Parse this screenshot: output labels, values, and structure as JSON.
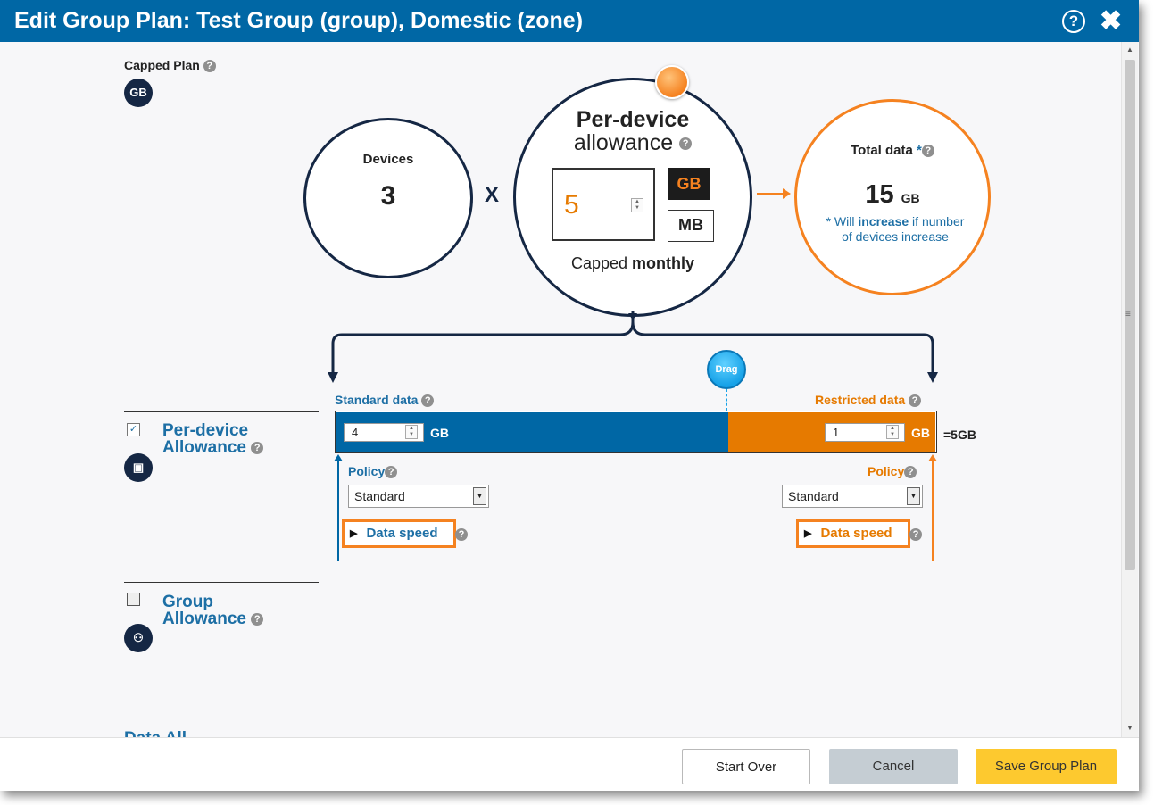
{
  "dialog": {
    "title": "Edit Group Plan: Test Group (group), Domestic (zone)",
    "help_icon": "?",
    "close_icon": "✖"
  },
  "plan": {
    "label": "Capped Plan",
    "badge": "GB"
  },
  "devices": {
    "label": "Devices",
    "value": "3"
  },
  "multiply": "X",
  "per_device": {
    "title_line1": "Per-device",
    "title_line2": "allowance",
    "value": "5",
    "unit_gb": "GB",
    "unit_mb": "MB",
    "capped_prefix": "Capped ",
    "capped_bold": "monthly",
    "selected_unit": "GB"
  },
  "total": {
    "label": "Total data",
    "asterisk": "*",
    "value": "15",
    "unit": "GB",
    "note_prefix": "* Will ",
    "note_bold": "increase",
    "note_suffix": " if number of devices increase"
  },
  "split": {
    "standard_label": "Standard data",
    "restricted_label": "Restricted data",
    "standard_value": "4",
    "restricted_value": "1",
    "unit": "GB",
    "total_label": "=5GB",
    "drag_label": "Drag",
    "standard_fraction": 0.8
  },
  "policy": {
    "left_label": "Policy",
    "right_label": "Policy",
    "left_selected": "Standard",
    "right_selected": "Standard",
    "data_speed_label": "Data speed"
  },
  "sections": {
    "per_device": {
      "line1": "Per-device",
      "line2": "Allowance",
      "checked": true
    },
    "group": {
      "line1": "Group",
      "line2": "Allowance",
      "checked": false
    },
    "cut_off": "Data All..."
  },
  "footer": {
    "start_over": "Start Over",
    "cancel": "Cancel",
    "save": "Save Group Plan"
  },
  "colors": {
    "primary": "#0067a5",
    "accent": "#f58220",
    "dark": "#152744",
    "save": "#fdc92f"
  }
}
